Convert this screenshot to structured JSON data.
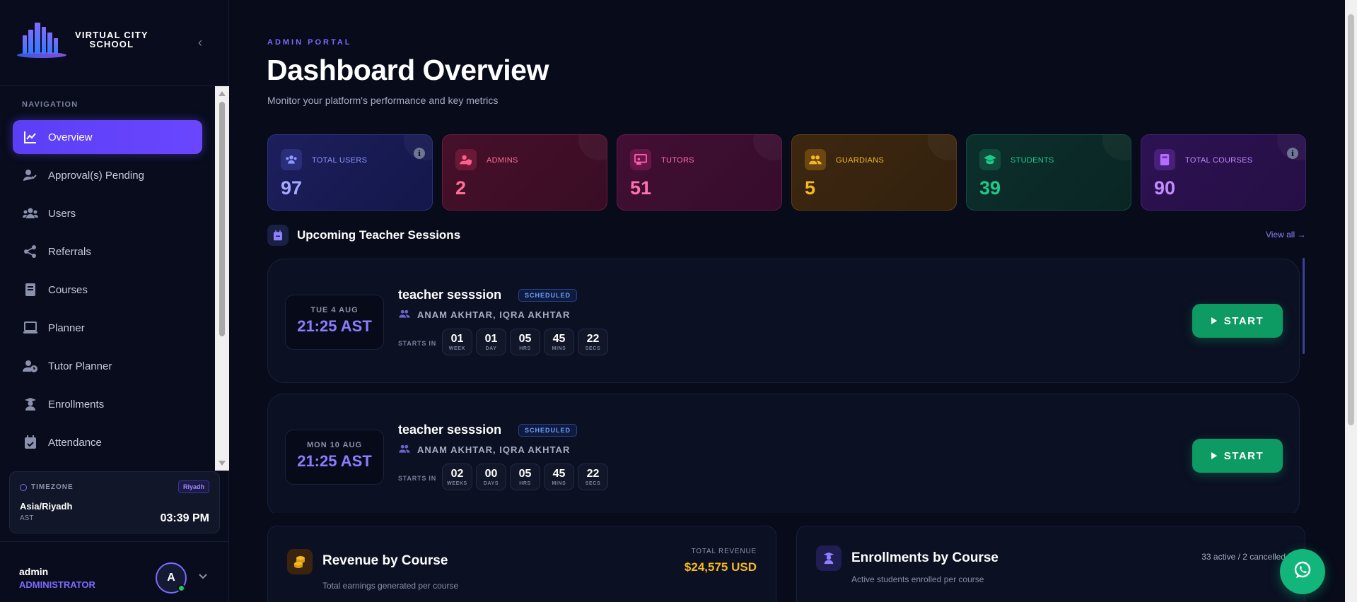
{
  "brand": {
    "line1": "VIRTUAL CITY",
    "line2": "SCHOOL"
  },
  "sidebar": {
    "heading": "NAVIGATION",
    "items": [
      {
        "label": "Overview",
        "icon": "chart-line-icon",
        "active": true
      },
      {
        "label": "Approval(s) Pending",
        "icon": "user-check-icon"
      },
      {
        "label": "Users",
        "icon": "users-icon"
      },
      {
        "label": "Referrals",
        "icon": "share-icon"
      },
      {
        "label": "Courses",
        "icon": "book-icon"
      },
      {
        "label": "Planner",
        "icon": "monitor-icon"
      },
      {
        "label": "Tutor Planner",
        "icon": "user-clock-icon"
      },
      {
        "label": "Enrollments",
        "icon": "graduate-icon"
      },
      {
        "label": "Attendance",
        "icon": "calendar-check-icon"
      }
    ],
    "timezone": {
      "label": "TIMEZONE",
      "badge": "Riyadh",
      "zone": "Asia/Riyadh",
      "abbr": "AST",
      "time": "03:39 PM"
    },
    "user": {
      "name": "admin",
      "role": "ADMINISTRATOR",
      "initial": "A"
    }
  },
  "header": {
    "eyebrow": "ADMIN PORTAL",
    "title": "Dashboard Overview",
    "subtitle": "Monitor your platform's performance and key metrics"
  },
  "stats": [
    {
      "label": "TOTAL USERS",
      "value": "97",
      "color": "#8f94ff",
      "icon": "users-icon"
    },
    {
      "label": "ADMINS",
      "value": "2",
      "color": "#ff5f8a",
      "icon": "user-shield-icon"
    },
    {
      "label": "TUTORS",
      "value": "51",
      "color": "#ff5fa8",
      "icon": "chalkboard-icon"
    },
    {
      "label": "GUARDIANS",
      "value": "5",
      "color": "#f5b920",
      "icon": "users-icon"
    },
    {
      "label": "STUDENTS",
      "value": "39",
      "color": "#1fc98a",
      "icon": "graduation-cap-icon"
    },
    {
      "label": "TOTAL COURSES",
      "value": "90",
      "color": "#b46bff",
      "icon": "book-icon"
    }
  ],
  "sessions_section": {
    "title": "Upcoming Teacher Sessions",
    "view_all": "View all →"
  },
  "sessions": [
    {
      "date": "TUE 4 AUG",
      "time": "21:25 AST",
      "name": "teacher sesssion",
      "status": "SCHEDULED",
      "participants": "ANAM AKHTAR, IQRA AKHTAR",
      "starts_in": "STARTS IN",
      "countdown": [
        {
          "n": "01",
          "u": "WEEK"
        },
        {
          "n": "01",
          "u": "DAY"
        },
        {
          "n": "05",
          "u": "HRS"
        },
        {
          "n": "45",
          "u": "MINS"
        },
        {
          "n": "22",
          "u": "SECS"
        }
      ],
      "action": "START"
    },
    {
      "date": "MON 10 AUG",
      "time": "21:25 AST",
      "name": "teacher sesssion",
      "status": "SCHEDULED",
      "participants": "ANAM AKHTAR, IQRA AKHTAR",
      "starts_in": "STARTS IN",
      "countdown": [
        {
          "n": "02",
          "u": "WEEKS"
        },
        {
          "n": "00",
          "u": "DAYS"
        },
        {
          "n": "05",
          "u": "HRS"
        },
        {
          "n": "45",
          "u": "MINS"
        },
        {
          "n": "22",
          "u": "SECS"
        }
      ],
      "action": "START"
    }
  ],
  "revenue": {
    "title": "Revenue by Course",
    "subtitle": "Total earnings generated per course",
    "total_label": "TOTAL REVENUE",
    "total_value": "$24,575 USD"
  },
  "enrollments": {
    "title": "Enrollments by Course",
    "subtitle": "Active students enrolled per course",
    "meta": "33 active / 2 cancelled"
  }
}
